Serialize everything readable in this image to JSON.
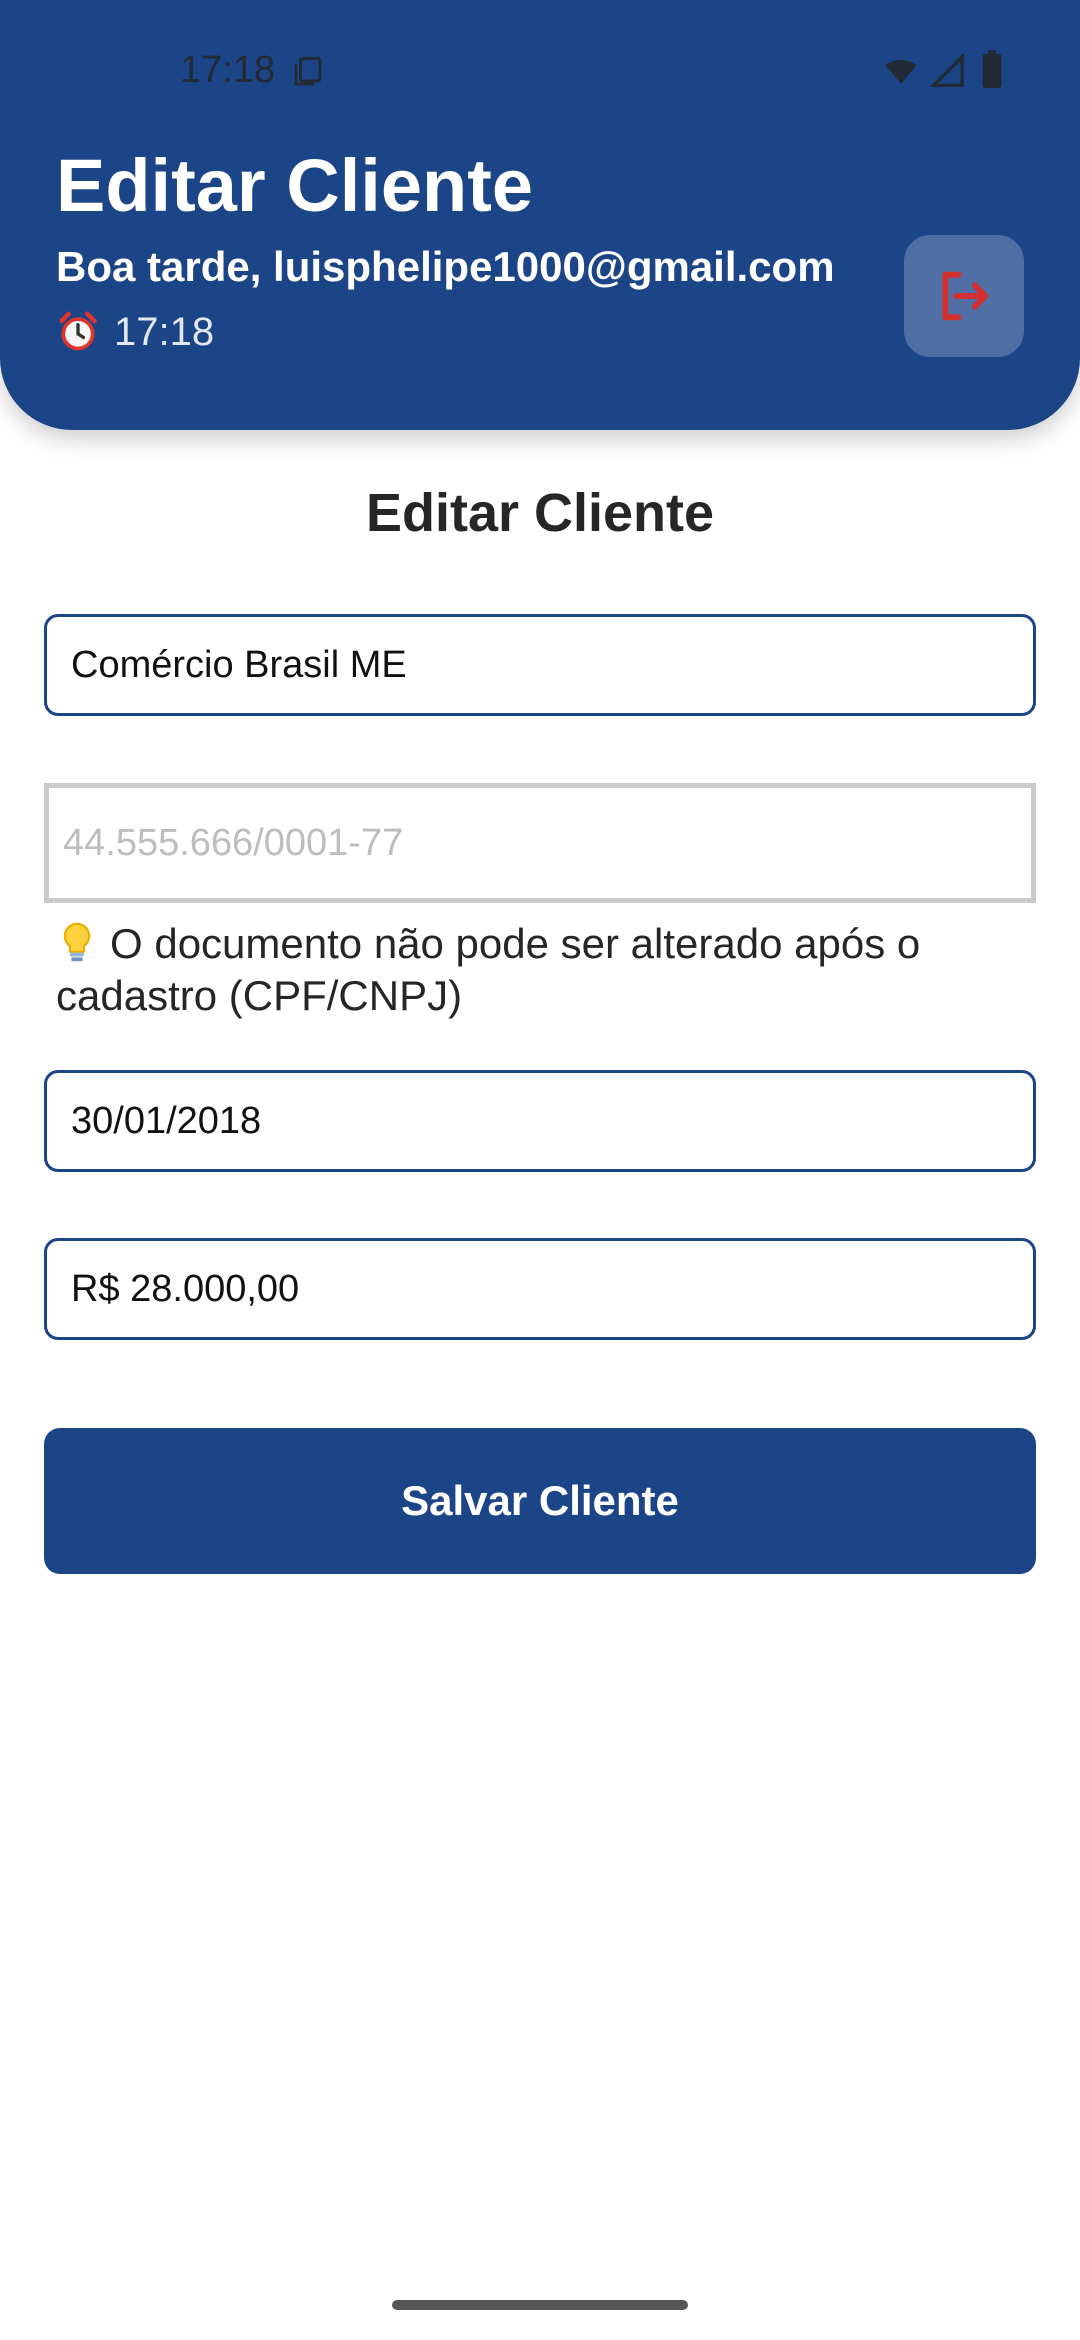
{
  "status_bar": {
    "time": "17:18",
    "icons": [
      "copy-icon",
      "wifi-icon",
      "cellular-signal-icon",
      "battery-icon"
    ]
  },
  "header": {
    "title": "Editar Cliente",
    "greeting": "Boa tarde, luisphelipe1000@gmail.com",
    "clock_icon": "alarm-clock-icon",
    "clock_time": "17:18",
    "logout_icon": "logout-icon"
  },
  "form": {
    "heading": "Editar Cliente",
    "name_value": "Comércio Brasil ME",
    "document_placeholder": "44.555.666/0001-77",
    "document_hint_icon": "lightbulb-icon",
    "document_hint": "O documento não pode ser alterado após o cadastro (CPF/CNPJ)",
    "date_value": "30/01/2018",
    "amount_value": "R$ 28.000,00",
    "save_label": "Salvar Cliente"
  },
  "colors": {
    "primary": "#1c4587",
    "logout_accent": "#d32f2f",
    "disabled_border": "#cacaca"
  }
}
